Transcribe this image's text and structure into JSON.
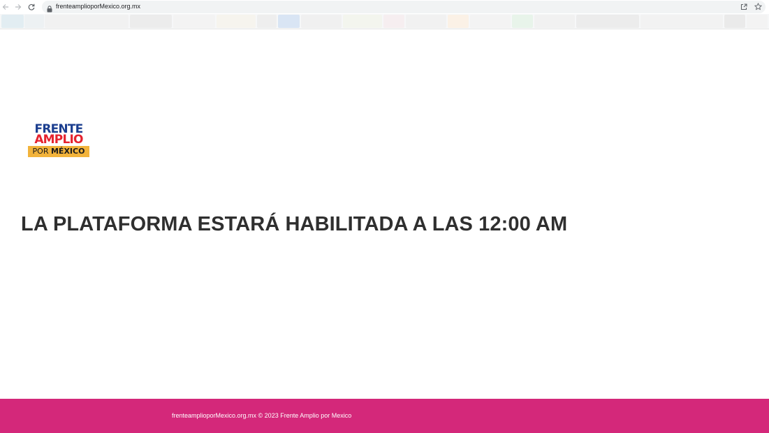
{
  "browser": {
    "url": "frenteamplioporMexico.org.mx",
    "icons": {
      "back": "arrow-left-icon",
      "forward": "arrow-right-icon",
      "reload": "reload-icon",
      "lock": "lock-icon",
      "share": "share-icon",
      "bookmark": "star-icon"
    }
  },
  "logo": {
    "line1": "FRENTE",
    "line2": "AMPLIO",
    "band_prefix": "POR ",
    "band_strong": "MÉXICO",
    "colors": {
      "frente": "#1b3e8f",
      "amplio": "#e5232f",
      "band": "#f2b33b"
    }
  },
  "main": {
    "headline": "LA PLATAFORMA ESTARÁ HABILITADA A LAS 12:00 AM"
  },
  "footer": {
    "text": "frenteamplioporMexico.org.mx © 2023 Frente Amplio por Mexico",
    "background": "#d4287a"
  }
}
